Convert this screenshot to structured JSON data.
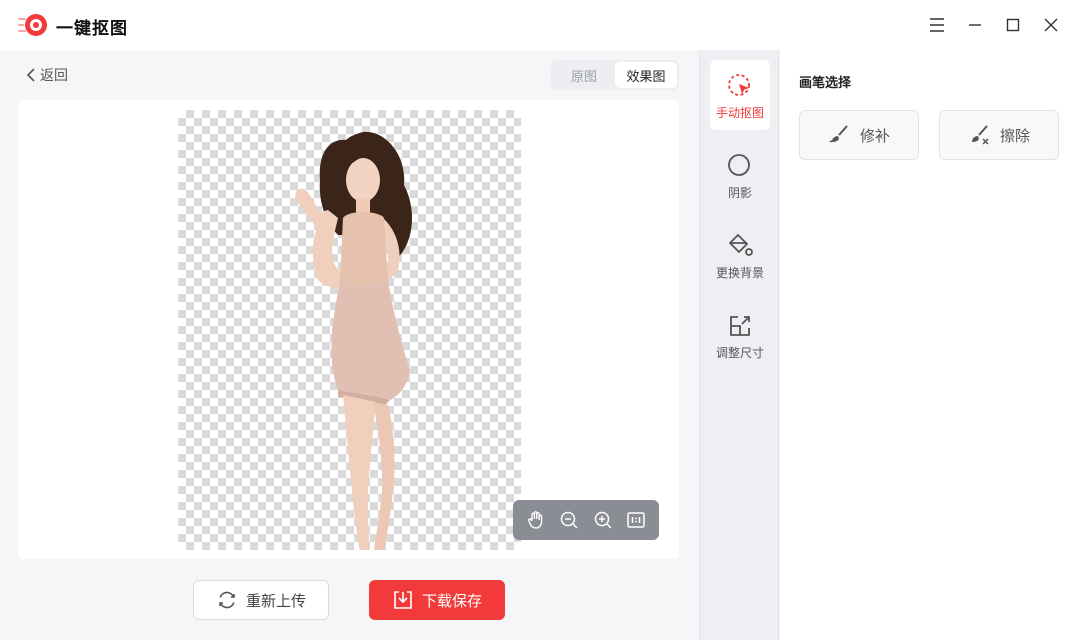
{
  "app": {
    "title": "一键抠图",
    "brand_color": "#f23a3a"
  },
  "window_controls": {
    "menu_icon": "menu-icon",
    "minimize_icon": "minimize-icon",
    "maximize_icon": "maximize-icon",
    "close_icon": "close-icon"
  },
  "nav": {
    "back_label": "返回"
  },
  "view_toggle": {
    "options": [
      "原图",
      "效果图"
    ],
    "selected": "效果图"
  },
  "canvas": {
    "background": "transparent-checkerboard"
  },
  "zoom_bar": {
    "icons": [
      "hand-pan-icon",
      "zoom-out-icon",
      "zoom-in-icon",
      "fit-actual-size-icon"
    ]
  },
  "actions": {
    "reupload_label": "重新上传",
    "download_label": "下载保存"
  },
  "tools": [
    {
      "label": "手动抠图",
      "icon": "manual-cutout-icon",
      "active": true
    },
    {
      "label": "阴影",
      "icon": "shadow-icon",
      "active": false
    },
    {
      "label": "更换背景",
      "icon": "paint-bucket-icon",
      "active": false
    },
    {
      "label": "调整尺寸",
      "icon": "resize-icon",
      "active": false
    }
  ],
  "panel": {
    "title": "画笔选择",
    "brushes": [
      {
        "label": "修补",
        "icon": "brush-repair-icon"
      },
      {
        "label": "擦除",
        "icon": "brush-erase-icon"
      }
    ]
  }
}
